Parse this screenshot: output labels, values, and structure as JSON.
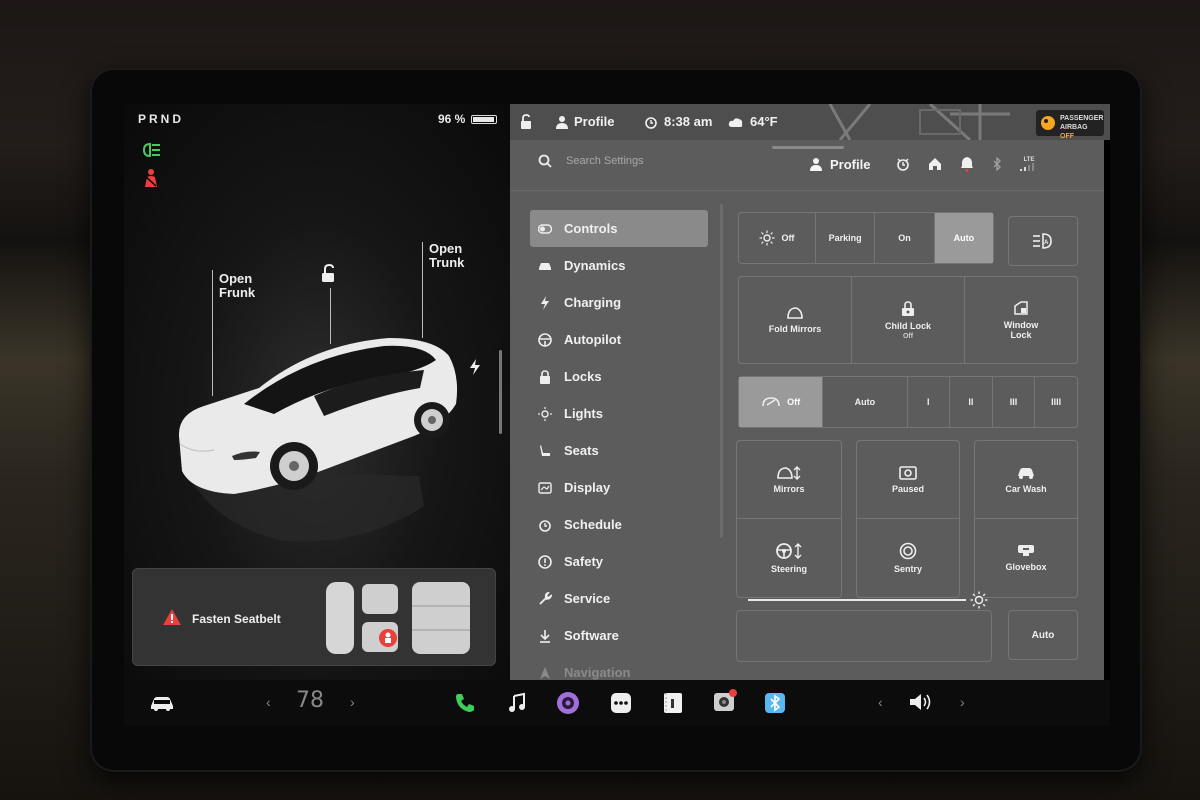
{
  "status": {
    "gear": "PRND",
    "battery_pct_text": "96 %",
    "battery_fraction": 0.96
  },
  "callouts": {
    "frunk": "Open\nFrunk",
    "trunk": "Open\nTrunk"
  },
  "alert": {
    "text": "Fasten Seatbelt"
  },
  "topbar": {
    "profile": "Profile",
    "time": "8:38 am",
    "temperature": "64°F",
    "airbag_line1": "PASSENGER",
    "airbag_line2": "AIRBAG",
    "airbag_state": "OFF"
  },
  "settings": {
    "search_placeholder": "Search Settings",
    "header_profile": "Profile",
    "lte_label": "LTE",
    "nav": [
      {
        "label": "Controls",
        "icon": "toggle-icon",
        "active": true
      },
      {
        "label": "Dynamics",
        "icon": "car-icon"
      },
      {
        "label": "Charging",
        "icon": "bolt-icon"
      },
      {
        "label": "Autopilot",
        "icon": "steering-wheel-icon"
      },
      {
        "label": "Locks",
        "icon": "lock-icon"
      },
      {
        "label": "Lights",
        "icon": "sun-icon"
      },
      {
        "label": "Seats",
        "icon": "seat-icon"
      },
      {
        "label": "Display",
        "icon": "display-icon"
      },
      {
        "label": "Schedule",
        "icon": "alarm-icon"
      },
      {
        "label": "Safety",
        "icon": "alert-icon"
      },
      {
        "label": "Service",
        "icon": "wrench-icon"
      },
      {
        "label": "Software",
        "icon": "download-icon"
      },
      {
        "label": "Navigation",
        "icon": "navigation-icon"
      }
    ],
    "headlights": {
      "options": [
        "Off",
        "Parking",
        "On",
        "Auto"
      ],
      "selected": "Auto"
    },
    "toggles_row": {
      "fold_mirrors": "Fold Mirrors",
      "child_lock": "Child Lock",
      "child_lock_state": "Off",
      "window_lock": "Window\nLock"
    },
    "wipers": {
      "options": [
        "Off",
        "Auto",
        "I",
        "II",
        "III",
        "IIII"
      ],
      "selected": "Off"
    },
    "tiles": {
      "mirrors": "Mirrors",
      "paused": "Paused",
      "car_wash": "Car Wash",
      "steering": "Steering",
      "sentry": "Sentry",
      "glovebox": "Glovebox"
    },
    "brightness": {
      "auto_label": "Auto",
      "level": 1.0
    }
  },
  "dock": {
    "temperature": "78",
    "left_chevron": "‹",
    "right_chevron": "›"
  },
  "colors": {
    "indicator_green": "#3ecf5a",
    "indicator_red": "#e8403a",
    "settings_bg": "#5c5c5c",
    "airbag_off": "#f5a623"
  }
}
